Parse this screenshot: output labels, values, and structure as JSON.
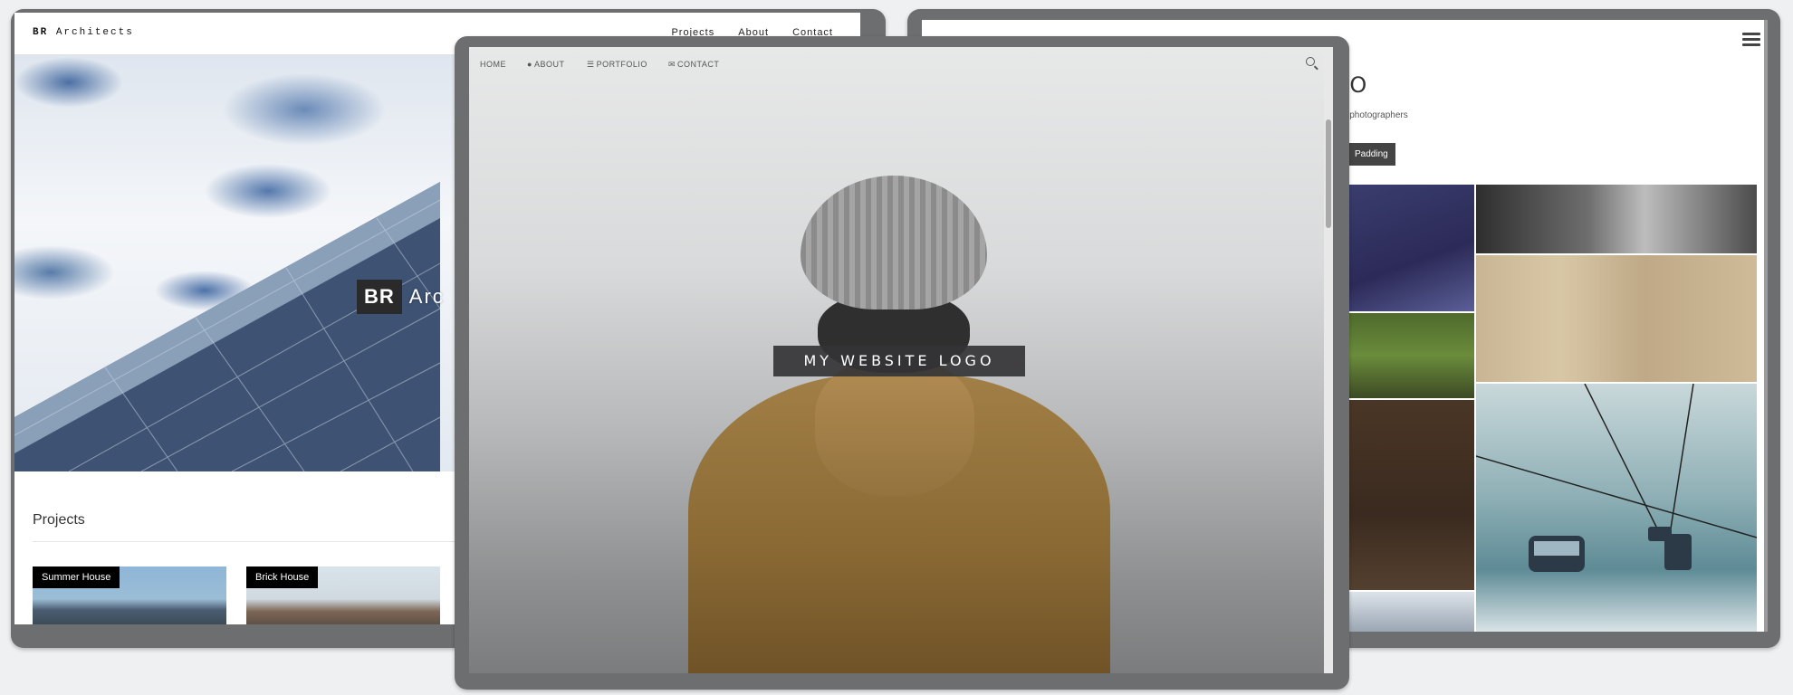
{
  "left_screen": {
    "logo_bold": "BR",
    "logo_text": "Architects",
    "nav": [
      "Projects",
      "About",
      "Contact"
    ],
    "hero_badge": "BR",
    "hero_text": "Arc",
    "section_title": "Projects",
    "projects": [
      "Summer House",
      "Brick House"
    ]
  },
  "center_screen": {
    "nav": {
      "home": "HOME",
      "about": "ABOUT",
      "portfolio": "PORTFOLIO",
      "contact": "CONTACT"
    },
    "logo_text": "MY WEBSITE LOGO"
  },
  "right_screen": {
    "title": "OLIO",
    "subtitle": "css for photographers",
    "button": "Padding"
  },
  "colors": {
    "frame": "#6d6e70",
    "page_background": "#eef0f1",
    "logo_box": "#343436"
  },
  "icons": {
    "about": "user-icon",
    "portfolio": "list-icon",
    "contact": "envelope-icon",
    "search": "search-icon",
    "menu": "hamburger-icon"
  }
}
